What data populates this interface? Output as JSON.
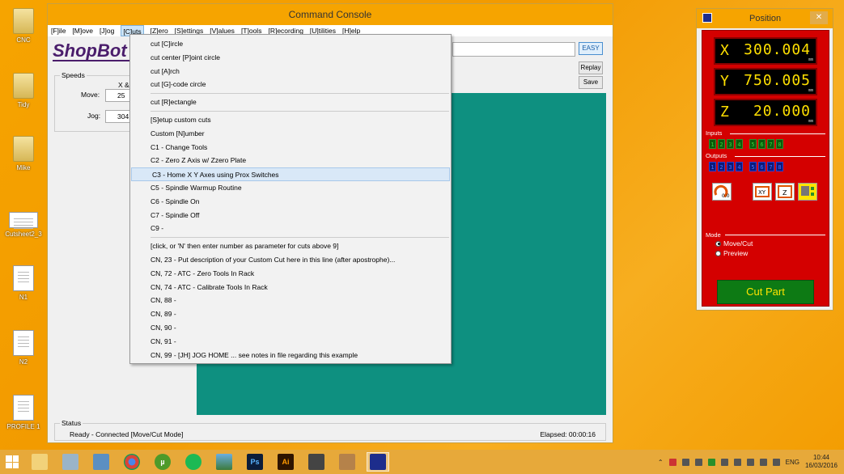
{
  "desktop": {
    "icons": [
      {
        "label": "CNC",
        "type": "folder"
      },
      {
        "label": "Tidy",
        "type": "folder"
      },
      {
        "label": "Mike",
        "type": "folder"
      },
      {
        "label": "Cutsheet2_3",
        "type": "file"
      },
      {
        "label": "N1",
        "type": "doc"
      },
      {
        "label": "N2",
        "type": "doc"
      },
      {
        "label": "PROFILE 1",
        "type": "doc"
      }
    ]
  },
  "console": {
    "title": "Command Console",
    "menu": [
      "[F]ile",
      "[M]ove",
      "[J]og",
      "[C]uts",
      "[Z]ero",
      "[S]ettings",
      "[V]alues",
      "[T]ools",
      "[R]ecording",
      "[U]tilities",
      "[H]elp"
    ],
    "active_menu": "[C]uts",
    "logo": "ShopBot",
    "buttons": {
      "easy": "EASY",
      "replay": "Replay",
      "save": "Save"
    },
    "speeds": {
      "legend": "Speeds",
      "col_header": "X &",
      "move_label": "Move:",
      "move_value": "25",
      "jog_label": "Jog:",
      "jog_value": "304"
    },
    "status": {
      "legend": "Status",
      "text": "Ready - Connected  [Move/Cut Mode]",
      "elapsed": "Elapsed: 00:00:16"
    }
  },
  "cuts_menu": {
    "group1": [
      "cut [C]ircle",
      "cut center [P]oint circle",
      "cut [A]rch",
      "cut [G]-code circle"
    ],
    "group2": [
      "cut [R]ectangle"
    ],
    "group3": [
      "[S]etup custom cuts",
      "Custom [N]umber",
      "C1  -  Change Tools",
      "C2  -  Zero Z Axis w/ Zzero Plate",
      "C3  -  Home X  Y Axes using Prox Switches",
      "C5  -  Spindle Warmup Routine",
      "C6  -  Spindle On",
      "C7  -  Spindle Off",
      "C9  -"
    ],
    "highlighted": "C3  -  Home X  Y Axes using Prox Switches",
    "group4": [
      "[click, or 'N' then enter number as parameter for cuts above 9]",
      "CN, 23  -  Put description of your Custom Cut here in this line (after apostrophe)...",
      "CN, 72  -  ATC - Zero Tools In Rack",
      "CN, 74  -  ATC - Calibrate Tools In Rack",
      "CN, 88  -",
      "CN, 89  -",
      "CN, 90  -",
      "CN, 91  -",
      "CN, 99  -  [JH] JOG HOME ... see notes in file regarding this example"
    ]
  },
  "position": {
    "title": "Position",
    "close": "✕",
    "axes": [
      {
        "letter": "X",
        "value": "300.004",
        "unit": "mm"
      },
      {
        "letter": "Y",
        "value": "750.005",
        "unit": "mm"
      },
      {
        "letter": "Z",
        "value": "20.000",
        "unit": "mm"
      }
    ],
    "inputs_label": "Inputs",
    "outputs_label": "Outputs",
    "io_numbers": [
      "1",
      "2",
      "3",
      "4",
      "5",
      "6",
      "7",
      "8"
    ],
    "mode_label": "Mode",
    "mode_options": [
      "Move/Cut",
      "Preview"
    ],
    "mode_selected": "Move/Cut",
    "cut_part": "Cut Part",
    "colors": {
      "panel": "#d40000",
      "readout": "#ffe000",
      "cut_part_bg": "#0d7a14"
    }
  },
  "taskbar": {
    "apps": [
      "file-explorer",
      "remote-desktop",
      "network-folder",
      "chrome",
      "utorrent",
      "spotify",
      "photos",
      "photoshop",
      "illustrator",
      "inkscape",
      "vectric",
      "shopbot"
    ],
    "ps_label": "Ps",
    "ai_label": "Ai",
    "language": "ENG",
    "time": "10:44",
    "date": "16/03/2016"
  }
}
